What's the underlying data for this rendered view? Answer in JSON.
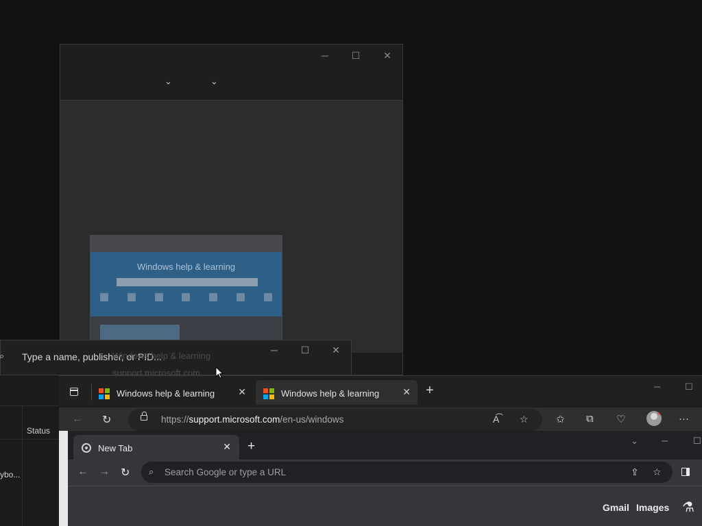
{
  "ghost_window": {
    "controls": {
      "minimize": "─",
      "maximize": "☐",
      "close": "✕"
    },
    "chevrons": [
      "⌄",
      "⌄"
    ],
    "thumbnail": {
      "hero_title": "Windows help & learning"
    }
  },
  "ghost_texts": {
    "tab_caption": "Windows help & learning",
    "site": "support.microsoft.com"
  },
  "search_window": {
    "search_icon": "⌕",
    "placeholder": "Type a name, publisher, or PID...",
    "controls": {
      "minimize": "─",
      "maximize": "☐",
      "close": "✕"
    }
  },
  "left_panel": {
    "column_status": "Status",
    "truncated_row": "ybo..."
  },
  "edge": {
    "tabs": [
      {
        "label": "Windows help & learning",
        "close": "✕"
      },
      {
        "label": "Windows help & learning",
        "close": "✕"
      }
    ],
    "new_tab": "+",
    "controls": {
      "minimize": "─",
      "maximize": "☐"
    },
    "nav": {
      "back": "←",
      "refresh": "↻"
    },
    "url": {
      "prefix": "https://",
      "domain": "support.microsoft.com",
      "path": "/en-us/windows"
    },
    "address_icons": {
      "read_aloud": "A͡",
      "favorite": "☆"
    },
    "toolbar": {
      "favorites": "✩",
      "collections": "⧉",
      "health": "♡",
      "more": "···"
    },
    "progress_fraction": 0.58
  },
  "chrome": {
    "tab": {
      "label": "New Tab",
      "close": "✕"
    },
    "new_tab": "+",
    "controls": {
      "dropdown": "⌄",
      "minimize": "─",
      "maximize": "☐"
    },
    "nav": {
      "back": "←",
      "forward": "→",
      "reload": "↻"
    },
    "omnibox": {
      "search_icon": "⌕",
      "placeholder": "Search Google or type a URL",
      "share": "⇪",
      "bookmark": "☆"
    },
    "ntp": {
      "gmail": "Gmail",
      "images": "Images",
      "labs": "⚗"
    }
  },
  "colors": {
    "background": "#121212",
    "edge_tab_active": "#2f2f2f",
    "chrome_frame": "#202124",
    "chrome_toolbar": "#35363a"
  }
}
